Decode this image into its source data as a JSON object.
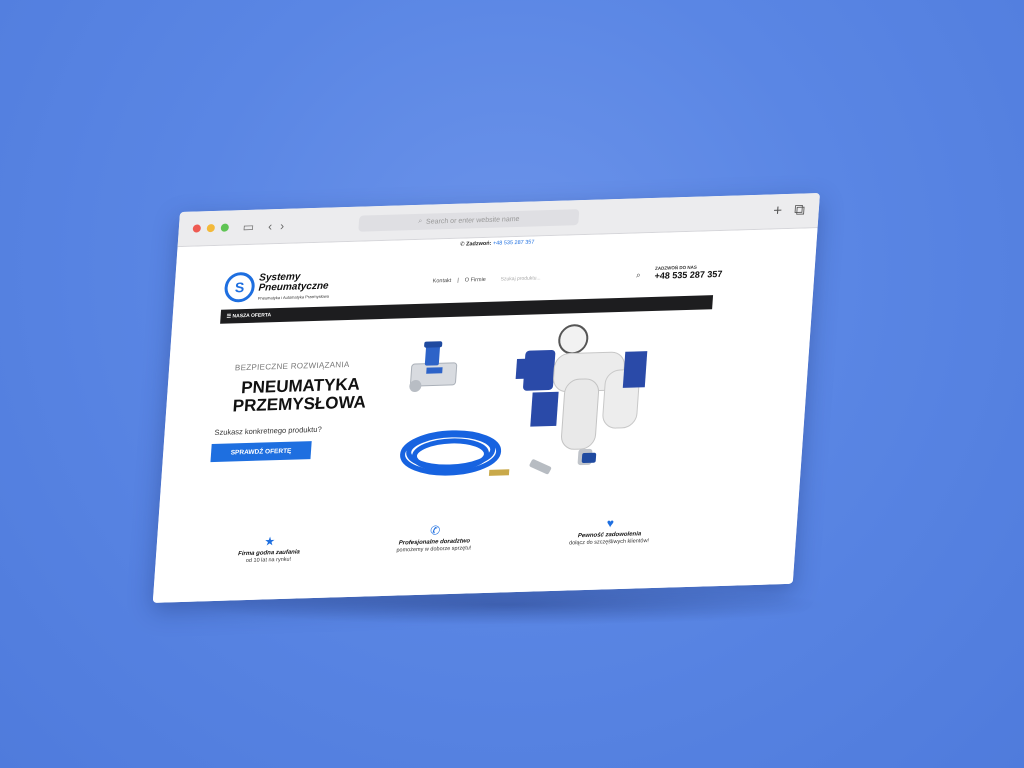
{
  "browser": {
    "address_placeholder": "Search or enter website name"
  },
  "site": {
    "topbar": {
      "label": "Zadzwoń:",
      "phone": "+48 535 287 357"
    },
    "logo": {
      "line1": "Systemy",
      "line2": "Pneumatyczne",
      "tagline": "Pneumatyka i Automatyka Przemysłowa"
    },
    "nav": [
      {
        "label": "Kontakt"
      },
      {
        "label": "O Firmie"
      }
    ],
    "search_placeholder": "Szukaj produktu...",
    "contact": {
      "label": "ZADZWOŃ DO NAS",
      "phone": "+48 535 287 357"
    },
    "offer_bar": "☰ NASZA OFERTA",
    "hero": {
      "kicker": "BEZPIECZNE ROZWIĄZANIA",
      "title_line1": "PNEUMATYKA",
      "title_line2": "PRZEMYSŁOWA",
      "question": "Szukasz konkretnego produktu?",
      "button": "SPRAWDŹ OFERTĘ"
    },
    "features": [
      {
        "icon": "star-icon",
        "title": "Firma godna zaufania",
        "subtitle": "od 10 lat na rynku!"
      },
      {
        "icon": "phone-icon",
        "title": "Profesjonalne doradztwo",
        "subtitle": "pomożemy w doborze sprzętu!"
      },
      {
        "icon": "heart-icon",
        "title": "Pewność zadowolenia",
        "subtitle": "dołącz do szczęśliwych klientów!"
      }
    ]
  },
  "colors": {
    "brand": "#1e6fe0",
    "background": "#5a86e4",
    "bar": "#1d1d1f"
  }
}
